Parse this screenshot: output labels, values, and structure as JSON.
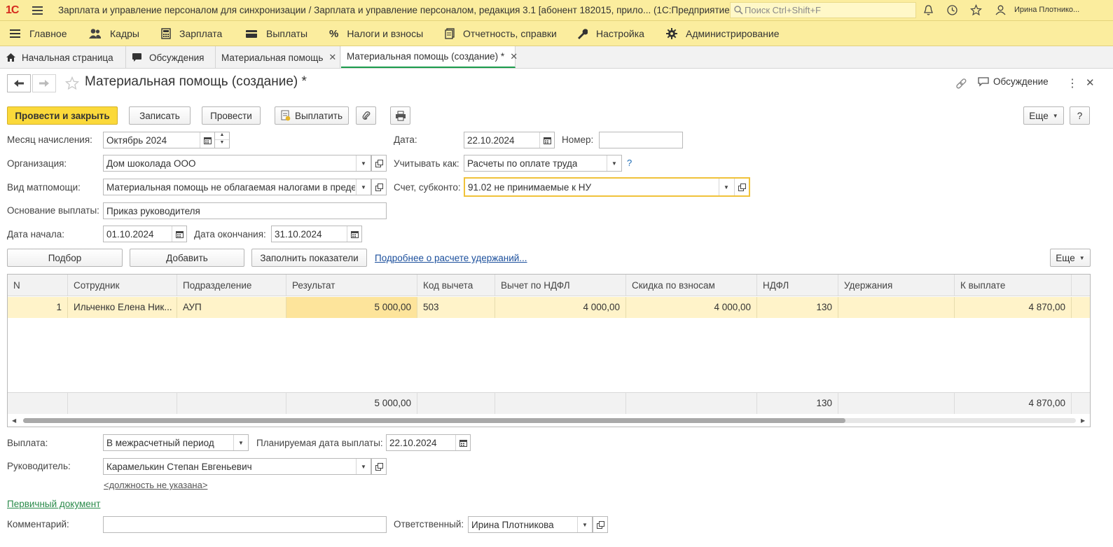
{
  "titlebar": {
    "logo": "1С",
    "title": "Зарплата и управление персоналом для синхронизации / Зарплата и управление персоналом, редакция 3.1 [абонент 182015, прило...  (1С:Предприятие)",
    "search_placeholder": "Поиск Ctrl+Shift+F",
    "user": "Ирина Плотнико..."
  },
  "sections": [
    {
      "label": "Главное",
      "icon": "menu-icon"
    },
    {
      "label": "Кадры",
      "icon": "people-icon"
    },
    {
      "label": "Зарплата",
      "icon": "calculator-icon"
    },
    {
      "label": "Выплаты",
      "icon": "wallet-icon"
    },
    {
      "label": "Налоги и взносы",
      "icon": "percent-icon"
    },
    {
      "label": "Отчетность, справки",
      "icon": "reports-icon"
    },
    {
      "label": "Настройка",
      "icon": "wrench-icon"
    },
    {
      "label": "Администрирование",
      "icon": "gear-icon"
    }
  ],
  "tabs": [
    {
      "label": "Начальная страница"
    },
    {
      "label": "Обсуждения"
    },
    {
      "label": "Материальная помощь"
    },
    {
      "label": "Материальная помощь (создание) *"
    }
  ],
  "form": {
    "title": "Материальная помощь (создание) *",
    "discussion": "Обсуждение",
    "toolbar": {
      "post_close": "Провести и закрыть",
      "save": "Записать",
      "post": "Провести",
      "pay": "Выплатить",
      "more": "Еще",
      "help": "?"
    },
    "month_label": "Месяц начисления:",
    "month_value": "Октябрь 2024",
    "date_label": "Дата:",
    "date_value": "22.10.2024",
    "number_label": "Номер:",
    "number_value": "",
    "org_label": "Организация:",
    "org_value": "Дом шоколада ООО",
    "account_as_label": "Учитывать как:",
    "account_as_value": "Расчеты по оплате труда",
    "account_as_help": "?",
    "aid_type_label": "Вид матпомощи:",
    "aid_type_value": "Материальная помощь не облагаемая налогами в предел",
    "account_label": "Счет, субконто:",
    "account_value": "91.02 не принимаемые к НУ",
    "basis_label": "Основание выплаты:",
    "basis_value": "Приказ руководителя",
    "start_label": "Дата начала:",
    "start_value": "01.10.2024",
    "end_label": "Дата окончания:",
    "end_value": "31.10.2024",
    "table_toolbar": {
      "pick": "Подбор",
      "add": "Добавить",
      "fill": "Заполнить показатели",
      "details_link": "Подробнее о расчете удержаний...",
      "more": "Еще"
    },
    "table": {
      "columns": [
        "N",
        "Сотрудник",
        "Подразделение",
        "Результат",
        "Код вычета",
        "Вычет по НДФЛ",
        "Скидка по взносам",
        "НДФЛ",
        "Удержания",
        "К выплате"
      ],
      "rows": [
        [
          "1",
          "Ильченко Елена Ник...",
          "АУП",
          "5 000,00",
          "503",
          "4 000,00",
          "4 000,00",
          "130",
          "",
          "4 870,00"
        ]
      ],
      "totals": {
        "result": "5 000,00",
        "ndfl": "130",
        "to_pay": "4 870,00"
      }
    },
    "payout_label": "Выплата:",
    "payout_value": "В межрасчетный период",
    "planned_date_label": "Планируемая дата выплаты:",
    "planned_date_value": "22.10.2024",
    "head_label": "Руководитель:",
    "head_value": "Карамелькин Степан Евгеньевич",
    "position_link": "<должность не указана>",
    "primary_doc_link": "Первичный документ",
    "comment_label": "Комментарий:",
    "comment_value": "",
    "responsible_label": "Ответственный:",
    "responsible_value": "Ирина Плотникова"
  }
}
